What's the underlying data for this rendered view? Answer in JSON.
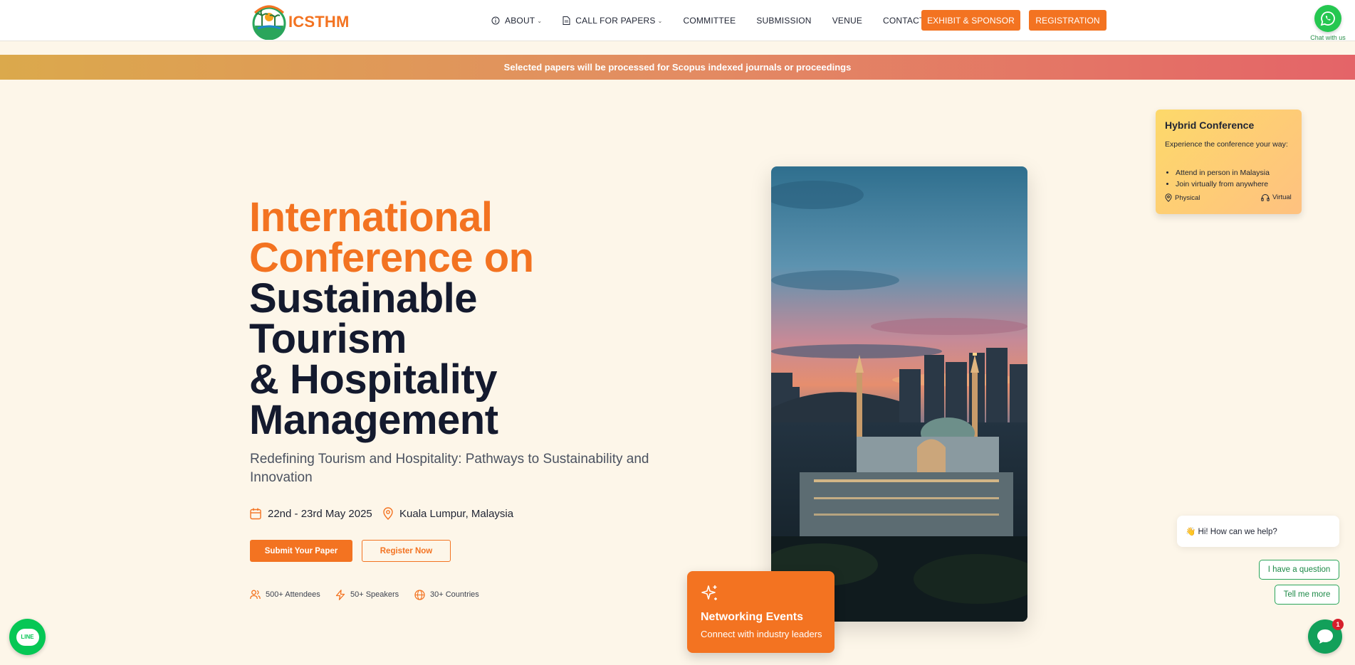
{
  "header": {
    "logo_text": "ICSTHM",
    "nav": [
      {
        "label": "ABOUT",
        "icon": "info-circle-icon",
        "dropdown": true
      },
      {
        "label": "CALL FOR PAPERS",
        "icon": "document-icon",
        "dropdown": true
      },
      {
        "label": "COMMITTEE"
      },
      {
        "label": "SUBMISSION"
      },
      {
        "label": "VENUE"
      },
      {
        "label": "CONTACT"
      }
    ],
    "exhibit_label": "EXHIBIT & SPONSOR",
    "registration_label": "REGISTRATION"
  },
  "whatsapp": {
    "label": "Chat with us",
    "icon": "whatsapp-icon"
  },
  "banner": {
    "text": "Selected papers will be processed for Scopus indexed journals or proceedings"
  },
  "hero": {
    "title_orange": [
      "International",
      "Conference on"
    ],
    "title_dark": [
      "Sustainable",
      "Tourism",
      "& Hospitality",
      "Management"
    ],
    "subtitle": "Redefining Tourism and Hospitality: Pathways to Sustainability and Innovation",
    "date": "22nd - 23rd May 2025",
    "location": "Kuala Lumpur, Malaysia",
    "submit_label": "Submit Your Paper",
    "register_label": "Register Now",
    "stats": [
      "500+ Attendees",
      "50+ Speakers",
      "30+ Countries"
    ]
  },
  "networking": {
    "title": "Networking Events",
    "subtitle": "Connect with industry leaders"
  },
  "hybrid": {
    "title": "Hybrid Conference",
    "description": "Experience the conference your way:",
    "points": [
      "Attend in person in Malaysia",
      "Join virtually from anywhere"
    ],
    "physical_label": "Physical",
    "virtual_label": "Virtual"
  },
  "chat": {
    "greeting": "👋 Hi! How can we help?",
    "option_1": "I have a question",
    "option_2": "Tell me more",
    "badge": "1"
  },
  "line": {
    "label": "LINE"
  },
  "colors": {
    "accent": "#f37321",
    "dark": "#141a2e",
    "background": "#fdf6e9",
    "whatsapp": "#25c750",
    "line": "#06c755"
  }
}
